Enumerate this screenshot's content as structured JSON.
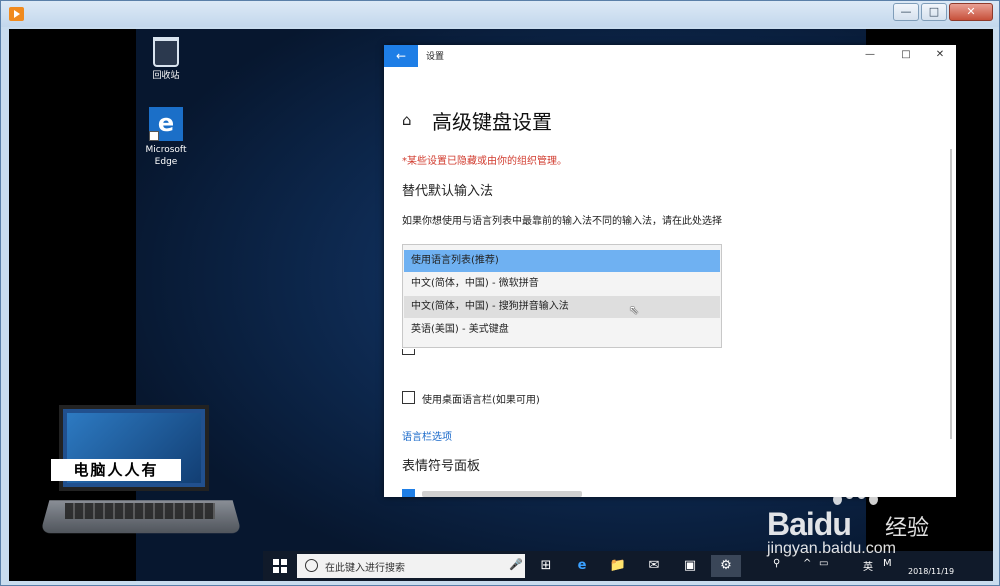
{
  "player": {
    "controls": {
      "minimize": "—",
      "maximize": "□",
      "close": "✕"
    }
  },
  "desktop": {
    "icons": [
      {
        "label": "回收站"
      },
      {
        "label": "Microsoft Edge",
        "glyph": "e"
      }
    ]
  },
  "settings_window": {
    "title": "设置",
    "back_glyph": "←",
    "controls": {
      "minimize": "—",
      "maximize": "□",
      "close": "✕"
    },
    "page_title": "高级键盘设置",
    "policy_note": "*某些设置已隐藏或由你的组织管理。",
    "section_override": {
      "heading": "替代默认输入法",
      "description": "如果你想使用与语言列表中最靠前的输入法不同的输入法，请在此处选择",
      "dropdown_options": [
        "使用语言列表(推荐)",
        "中文(简体，中国) - 微软拼音",
        "中文(简体，中国) - 搜狗拼音输入法",
        "英语(美国) - 美式键盘"
      ],
      "selected_index": 0,
      "hovered_index": 2
    },
    "desktop_langbar_checkbox": {
      "label": "使用桌面语言栏(如果可用)",
      "checked": false
    },
    "langbar_options_link": "语言栏选项",
    "section_emoji": {
      "heading": "表情符号面板"
    }
  },
  "taskbar": {
    "search_placeholder": "在此键入进行搜索",
    "mic_glyph": "🎤",
    "apps": [
      {
        "glyph": "⊞"
      },
      {
        "glyph": "e"
      },
      {
        "glyph": "📁"
      },
      {
        "glyph": "✉"
      },
      {
        "glyph": "▣"
      },
      {
        "glyph": "⚙"
      }
    ],
    "tray": {
      "people": "⚲",
      "chevron": "^",
      "battery": "▭",
      "ime": "英",
      "ime2": "M"
    },
    "date": "2018/11/19"
  },
  "watermarks": {
    "laptop_caption": "电脑人人有",
    "baidu_logo": "Baidu",
    "baidu_jy": "经验",
    "baidu_url": "jingyan.baidu.com"
  },
  "colors": {
    "accent": "#1e7ee6",
    "selected_option": "#6fb1f2",
    "hover_option": "#dedede",
    "policy_note": "#d13b2e",
    "link": "#1667c9"
  },
  "icons": {
    "player": "media-player-icon",
    "home": "home-icon",
    "back": "back-arrow-icon",
    "cursor": "mouse-cursor-icon"
  }
}
